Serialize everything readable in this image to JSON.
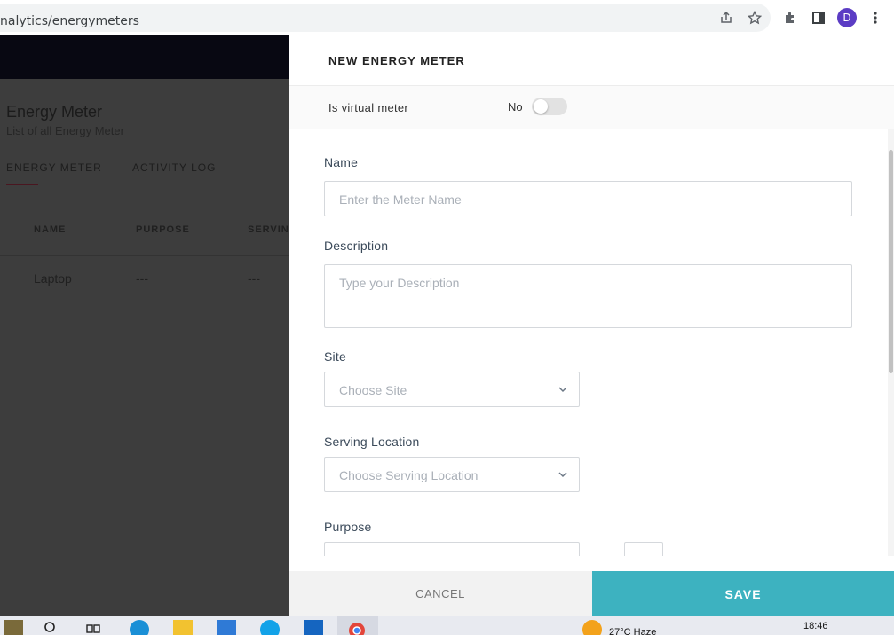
{
  "browser": {
    "url": "nalytics/energymeters",
    "avatar_letter": "D"
  },
  "background_app": {
    "title": "Energy Meter",
    "subtitle": "List of all Energy Meter",
    "tabs": [
      "ENERGY METER",
      "ACTIVITY LOG"
    ],
    "table": {
      "headers": [
        "NAME",
        "PURPOSE",
        "SERVIN"
      ],
      "rows": [
        [
          "Laptop",
          "---",
          "---"
        ]
      ]
    }
  },
  "panel": {
    "title": "NEW ENERGY METER",
    "virtual_meter": {
      "label": "Is virtual meter",
      "value": "No"
    },
    "fields": {
      "name": {
        "label": "Name",
        "placeholder": "Enter the Meter Name"
      },
      "description": {
        "label": "Description",
        "placeholder": "Type your Description"
      },
      "site": {
        "label": "Site",
        "placeholder": "Choose Site"
      },
      "serving_location": {
        "label": "Serving Location",
        "placeholder": "Choose Serving Location"
      },
      "purpose": {
        "label": "Purpose"
      }
    },
    "buttons": {
      "cancel": "CANCEL",
      "save": "SAVE"
    }
  },
  "taskbar": {
    "clock": "18:46",
    "weather": "27°C  Haze"
  },
  "colors": {
    "save_button": "#3db2c0",
    "cancel_button": "#f2f2f2",
    "overlay": "#3d3d3d"
  }
}
